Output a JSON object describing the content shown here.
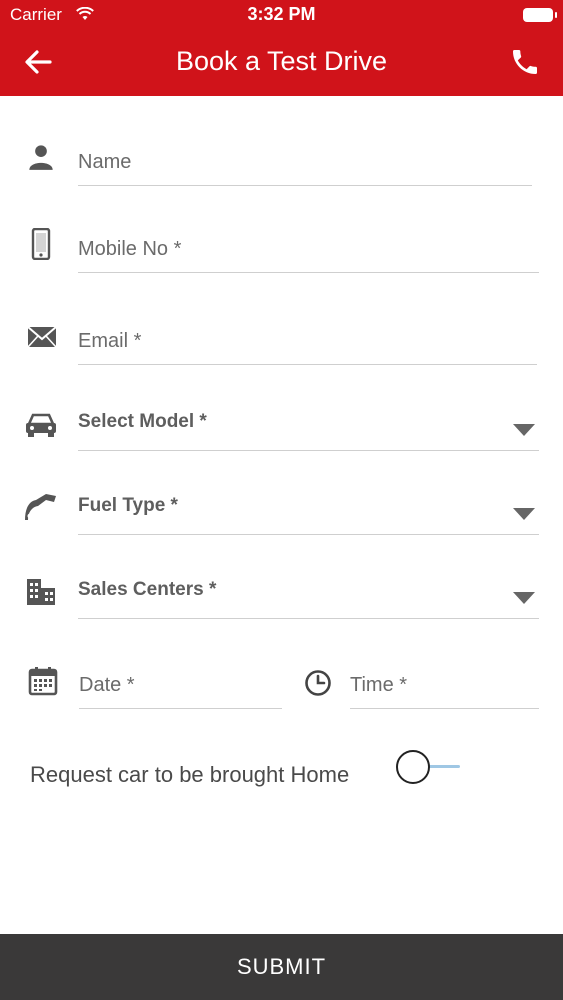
{
  "status_bar": {
    "carrier": "Carrier",
    "time": "3:32 PM"
  },
  "header": {
    "title": "Book a Test Drive",
    "back_icon": "arrow-left-icon",
    "call_icon": "phone-icon",
    "color": "#d0131a"
  },
  "form": {
    "name": {
      "label": "Name",
      "icon": "person-icon"
    },
    "mobile": {
      "label": "Mobile No *",
      "icon": "mobile-phone-icon"
    },
    "email": {
      "label": "Email *",
      "icon": "envelope-icon"
    },
    "model": {
      "label": "Select Model *",
      "icon": "car-icon"
    },
    "fuel": {
      "label": "Fuel Type *",
      "icon": "fuel-nozzle-icon"
    },
    "sales_center": {
      "label": "Sales Centers *",
      "icon": "buildings-icon"
    },
    "date": {
      "label": "Date *",
      "icon": "calendar-icon"
    },
    "time": {
      "label": "Time *",
      "icon": "clock-icon"
    }
  },
  "home_request": {
    "label": "Request car to be brought Home",
    "enabled": false
  },
  "submit": {
    "label": "SUBMIT",
    "color": "#3a3939"
  }
}
